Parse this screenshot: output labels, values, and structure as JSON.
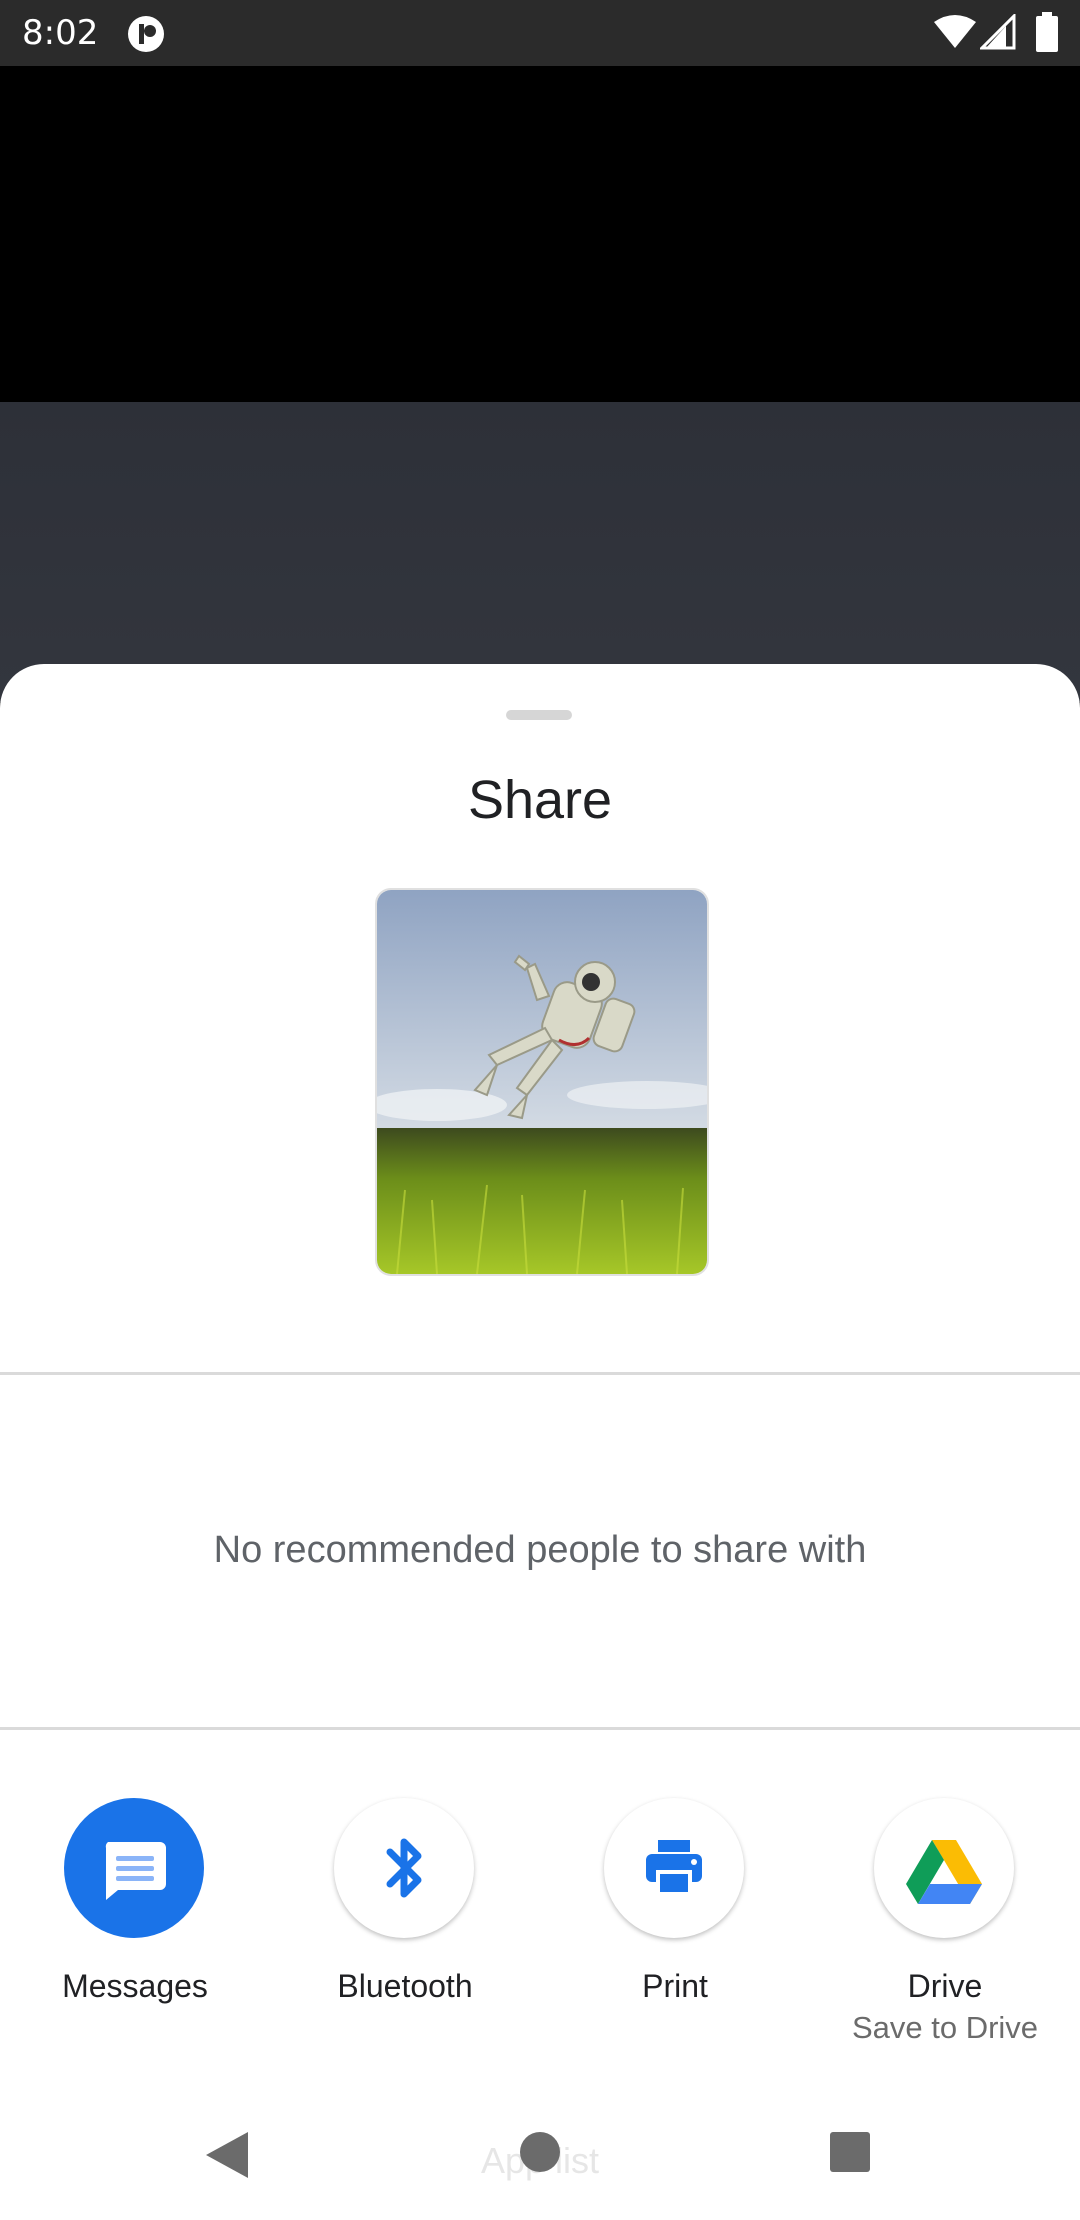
{
  "status_bar": {
    "time": "8:02"
  },
  "sheet": {
    "title": "Share",
    "no_people_text": "No recommended people to share with",
    "targets": [
      {
        "label": "Messages",
        "icon": "messages-icon",
        "color": "#1a73e8"
      },
      {
        "label": "Bluetooth",
        "icon": "bluetooth-icon",
        "color": "#1a73e8"
      },
      {
        "label": "Print",
        "icon": "print-icon",
        "color": "#1a73e8"
      },
      {
        "label": "Drive",
        "sublabel": "Save to Drive",
        "icon": "drive-icon"
      }
    ]
  },
  "nav_bar": {
    "faded_label": "App list"
  }
}
